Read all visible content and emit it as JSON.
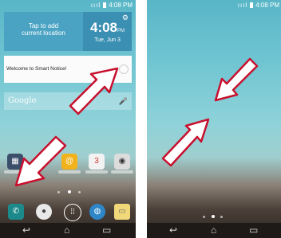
{
  "left_screen": {
    "status": {
      "time": "4:08 PM",
      "signal": "ıııl"
    },
    "weather_widget": {
      "line1": "Tap to add",
      "line2": "current location"
    },
    "clock_widget": {
      "time": "4:08",
      "ampm": "PM",
      "date": "Tue, Jun 3"
    },
    "notice": {
      "text": "Welcome to Smart Notice!"
    },
    "search": {
      "brand": "Google",
      "hint": "Google"
    },
    "calendar_day": "3"
  },
  "right_screen": {
    "status": {
      "time": "4:08 PM",
      "signal": "ıııl"
    }
  },
  "icons": {
    "settings": "gear-icon",
    "mic": "microphone-icon",
    "phone": "phone-icon",
    "contacts": "contacts-icon",
    "apps": "apps-icon",
    "browser": "globe-icon",
    "messaging": "message-icon",
    "back": "back-icon",
    "home": "home-icon",
    "recents": "recents-icon"
  },
  "colors": {
    "arrow_fill": "#ffffff",
    "arrow_stroke": "#c8102e"
  }
}
